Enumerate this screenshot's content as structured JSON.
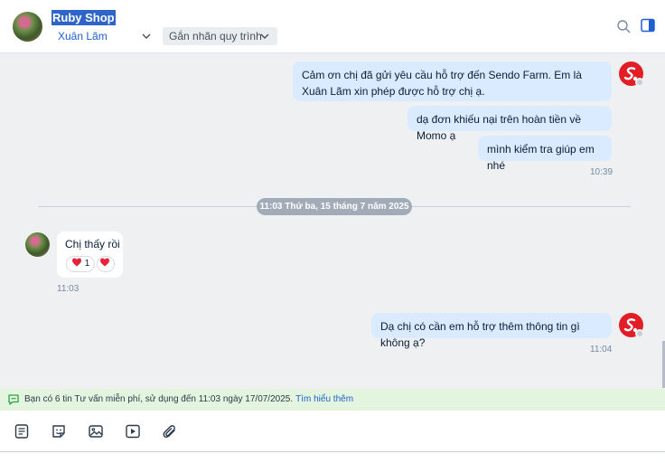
{
  "header": {
    "shop_name": "Ruby Shop",
    "assignee": "Xuân Lãm",
    "tag_label": "Gắn nhãn quy trình",
    "icons": [
      "search-icon",
      "side-panel-icon",
      "chevron-down-icon"
    ]
  },
  "messages": {
    "out1": "Cảm ơn chị đã gửi yêu cầu hỗ trợ đến Sendo Farm. Em là Xuân Lãm xin phép được hỗ trợ chị ạ.",
    "out2": "dạ đơn khiếu nại trên hoàn tiền về Momo ạ",
    "out3": "mình kiểm tra giúp em nhé",
    "time1": "10:39",
    "date_divider": "11:03 Thứ ba, 15 tháng 7 năm 2025",
    "in1": "Chị thấy rồi",
    "reaction_count": "1",
    "time2": "11:03",
    "out4": "Dạ chị có cần em hỗ trợ thêm thông tin gì không ạ?",
    "time3": "11:04"
  },
  "notice": {
    "text": "Bạn có 6 tin Tư vấn miễn phí, sử dụng đến 11:03 ngày 17/07/2025.",
    "link": "Tìm hiểu thêm"
  },
  "toolbar": {
    "icons": [
      "quick-message-icon",
      "sticker-icon",
      "image-icon",
      "video-icon",
      "attachment-icon"
    ]
  },
  "colors": {
    "accent": "#1f5fd1",
    "outgoing_bubble": "#dbebff",
    "sendo_red": "#e31d25",
    "notice_bg": "#e3f5df"
  }
}
